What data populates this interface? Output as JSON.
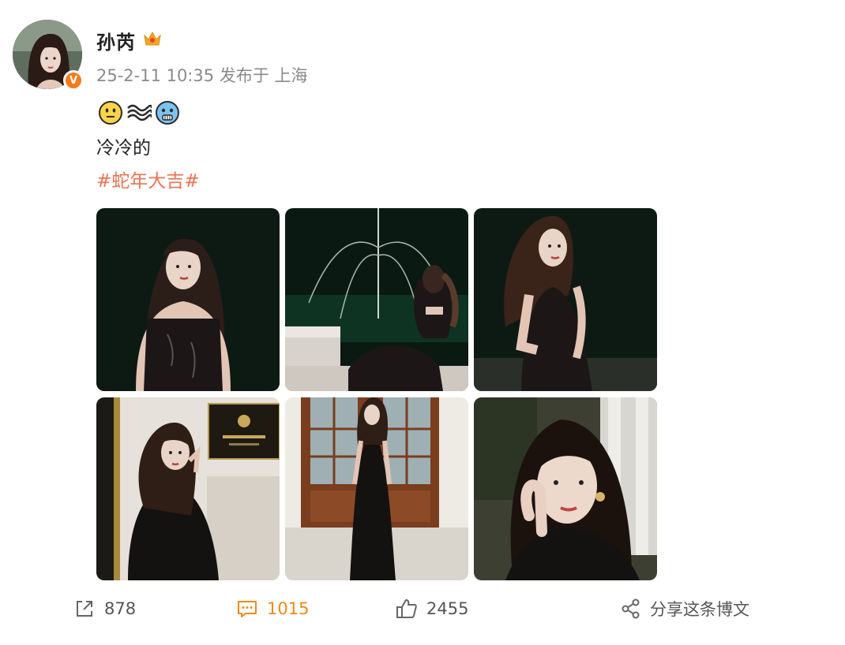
{
  "user": {
    "name": "孙芮",
    "avatar_icon": "avatar-photo",
    "verified_icon": "orange-v-badge",
    "level_icon": "crown-icon"
  },
  "post": {
    "meta": "25-2-11 10:35 发布于 上海",
    "emojis": [
      "neutral-face-emoji",
      "wave-emoji",
      "cold-face-emoji"
    ],
    "text": "冷冷的",
    "hashtag": "#蛇年大吉#",
    "photos": [
      {
        "icon": "photo-woman-black-dress-night"
      },
      {
        "icon": "photo-fountain-back-view"
      },
      {
        "icon": "photo-woman-black-dress-posing"
      },
      {
        "icon": "photo-woman-black-coat-door"
      },
      {
        "icon": "photo-woman-long-dress-wooden-door"
      },
      {
        "icon": "photo-woman-closeup-earring"
      }
    ]
  },
  "actions": {
    "repost_count": "878",
    "comment_count": "1015",
    "like_count": "2455",
    "share_label": "分享这条博文"
  },
  "colors": {
    "hashtag": "#eb7350",
    "comment_active": "#f08a17",
    "verified": "#f57b1c"
  }
}
